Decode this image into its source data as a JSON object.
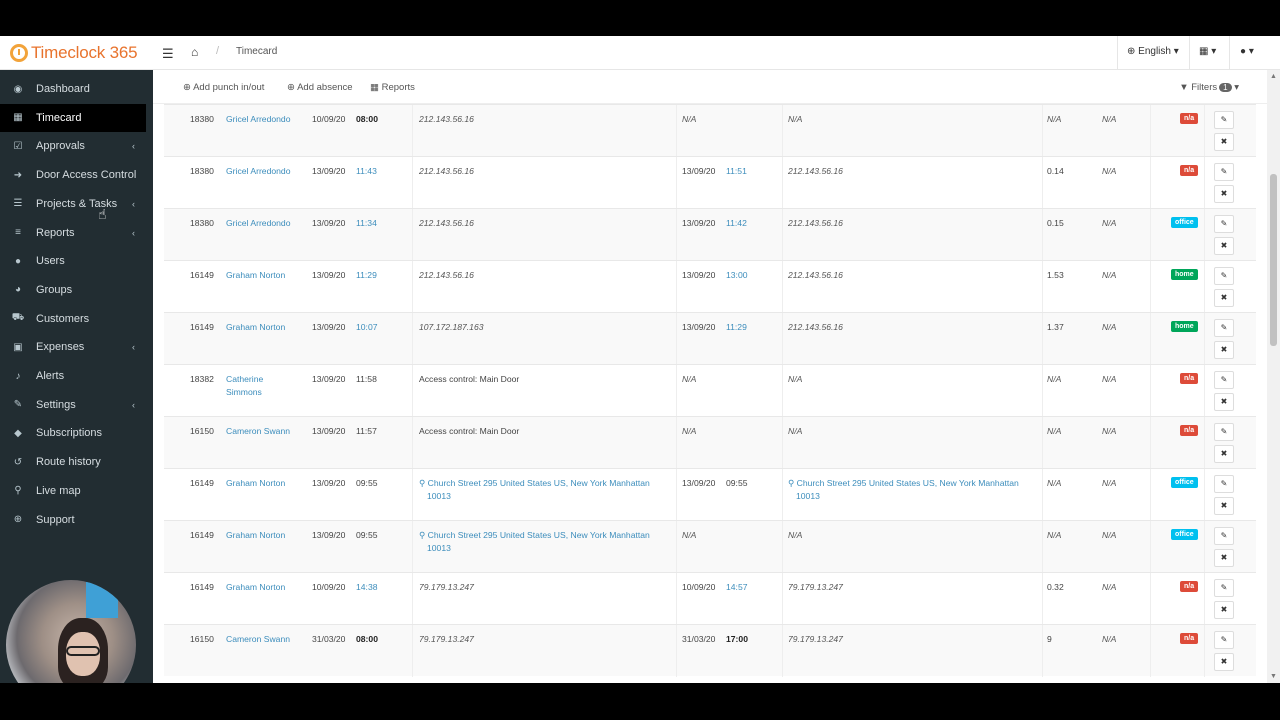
{
  "app": {
    "logo_text": "Timeclock 365",
    "breadcrumb_page": "Timecard",
    "language": "English ▾",
    "grid_menu": "▾",
    "user_menu": "▾"
  },
  "sidebar": {
    "items": [
      {
        "label": "Dashboard",
        "icon": "dashboard-icon",
        "glyph": "◉",
        "chevron": false
      },
      {
        "label": "Timecard",
        "icon": "calendar-icon",
        "glyph": "▦",
        "chevron": false,
        "active": true
      },
      {
        "label": "Approvals",
        "icon": "check-icon",
        "glyph": "☑",
        "chevron": true
      },
      {
        "label": "Door Access Control",
        "icon": "sign-in-icon",
        "glyph": "➜",
        "chevron": false
      },
      {
        "label": "Projects & Tasks",
        "icon": "list-icon",
        "glyph": "☰",
        "chevron": true
      },
      {
        "label": "Reports",
        "icon": "bars-icon",
        "glyph": "≡",
        "chevron": true
      },
      {
        "label": "Users",
        "icon": "user-icon",
        "glyph": "●",
        "chevron": false
      },
      {
        "label": "Groups",
        "icon": "users-icon",
        "glyph": "◕",
        "chevron": false
      },
      {
        "label": "Customers",
        "icon": "cart-icon",
        "glyph": "⛟",
        "chevron": false
      },
      {
        "label": "Expenses",
        "icon": "money-icon",
        "glyph": "▣",
        "chevron": true
      },
      {
        "label": "Alerts",
        "icon": "bell-icon",
        "glyph": "♪",
        "chevron": false
      },
      {
        "label": "Settings",
        "icon": "wrench-icon",
        "glyph": "✎",
        "chevron": true
      },
      {
        "label": "Subscriptions",
        "icon": "tags-icon",
        "glyph": "◆",
        "chevron": false
      },
      {
        "label": "Route history",
        "icon": "history-icon",
        "glyph": "↺",
        "chevron": false
      },
      {
        "label": "Live map",
        "icon": "map-marker-icon",
        "glyph": "⚲",
        "chevron": false
      },
      {
        "label": "Support",
        "icon": "globe-icon",
        "glyph": "⊕",
        "chevron": false
      }
    ],
    "chevron_glyph": "‹"
  },
  "toolbar": {
    "add_punch": "Add punch in/out",
    "add_absence": "Add absence",
    "reports": "Reports",
    "filters": "Filters",
    "filters_count": "1"
  },
  "rows": [
    {
      "id": "18380",
      "name": "Gricel Arredondo",
      "name2": "",
      "in_date": "10/09/20",
      "in_time": "08:00",
      "in_time_style": "bold",
      "in_loc": "212.143.56.16",
      "in_loc2": "",
      "in_loc_style": "ital",
      "out_date": "",
      "out_time": "",
      "out_time_style": "",
      "out_na": "N/A",
      "out_loc": "N/A",
      "out_loc2": "",
      "out_loc_style": "ital",
      "hours": "N/A",
      "hours_style": "ital",
      "extra": "N/A",
      "tag": "n/a",
      "tag_color": "red"
    },
    {
      "id": "18380",
      "name": "Gricel Arredondo",
      "name2": "",
      "in_date": "13/09/20",
      "in_time": "11:43",
      "in_time_style": "link",
      "in_loc": "212.143.56.16",
      "in_loc2": "",
      "in_loc_style": "ital",
      "out_date": "13/09/20",
      "out_time": "11:51",
      "out_time_style": "link",
      "out_na": "",
      "out_loc": "212.143.56.16",
      "out_loc2": "",
      "out_loc_style": "ital",
      "hours": "0.14",
      "hours_style": "",
      "extra": "N/A",
      "tag": "n/a",
      "tag_color": "red"
    },
    {
      "id": "18380",
      "name": "Gricel Arredondo",
      "name2": "",
      "in_date": "13/09/20",
      "in_time": "11:34",
      "in_time_style": "link",
      "in_loc": "212.143.56.16",
      "in_loc2": "",
      "in_loc_style": "ital",
      "out_date": "13/09/20",
      "out_time": "11:42",
      "out_time_style": "link",
      "out_na": "",
      "out_loc": "212.143.56.16",
      "out_loc2": "",
      "out_loc_style": "ital",
      "hours": "0.15",
      "hours_style": "",
      "extra": "N/A",
      "tag": "office",
      "tag_color": "blue"
    },
    {
      "id": "16149",
      "name": "Graham Norton",
      "name2": "",
      "in_date": "13/09/20",
      "in_time": "11:29",
      "in_time_style": "link",
      "in_loc": "212.143.56.16",
      "in_loc2": "",
      "in_loc_style": "ital",
      "out_date": "13/09/20",
      "out_time": "13:00",
      "out_time_style": "link",
      "out_na": "",
      "out_loc": "212.143.56.16",
      "out_loc2": "",
      "out_loc_style": "ital",
      "hours": "1.53",
      "hours_style": "",
      "extra": "N/A",
      "tag": "home",
      "tag_color": "green"
    },
    {
      "id": "16149",
      "name": "Graham Norton",
      "name2": "",
      "in_date": "13/09/20",
      "in_time": "10:07",
      "in_time_style": "link",
      "in_loc": "107.172.187.163",
      "in_loc2": "",
      "in_loc_style": "ital",
      "out_date": "13/09/20",
      "out_time": "11:29",
      "out_time_style": "link",
      "out_na": "",
      "out_loc": "212.143.56.16",
      "out_loc2": "",
      "out_loc_style": "ital",
      "hours": "1.37",
      "hours_style": "",
      "extra": "N/A",
      "tag": "home",
      "tag_color": "green"
    },
    {
      "id": "18382",
      "name": "Catherine",
      "name2": "Simmons",
      "in_date": "13/09/20",
      "in_time": "11:58",
      "in_time_style": "",
      "in_loc": "Access control: Main Door",
      "in_loc2": "",
      "in_loc_style": "",
      "out_date": "",
      "out_time": "",
      "out_time_style": "",
      "out_na": "N/A",
      "out_loc": "N/A",
      "out_loc2": "",
      "out_loc_style": "ital",
      "hours": "N/A",
      "hours_style": "ital",
      "extra": "N/A",
      "tag": "n/a",
      "tag_color": "red"
    },
    {
      "id": "16150",
      "name": "Cameron Swann",
      "name2": "",
      "in_date": "13/09/20",
      "in_time": "11:57",
      "in_time_style": "",
      "in_loc": "Access control: Main Door",
      "in_loc2": "",
      "in_loc_style": "",
      "out_date": "",
      "out_time": "",
      "out_time_style": "",
      "out_na": "N/A",
      "out_loc": "N/A",
      "out_loc2": "",
      "out_loc_style": "ital",
      "hours": "N/A",
      "hours_style": "ital",
      "extra": "N/A",
      "tag": "n/a",
      "tag_color": "red"
    },
    {
      "id": "16149",
      "name": "Graham Norton",
      "name2": "",
      "in_date": "13/09/20",
      "in_time": "09:55",
      "in_time_style": "",
      "in_loc": "⚲ Church Street 295 United States US, New York Manhattan",
      "in_loc2": "10013",
      "in_loc_style": "link",
      "out_date": "13/09/20",
      "out_time": "09:55",
      "out_time_style": "",
      "out_na": "",
      "out_loc": "⚲ Church Street 295 United States US, New York Manhattan",
      "out_loc2": "10013",
      "out_loc_style": "link",
      "hours": "N/A",
      "hours_style": "ital",
      "extra": "N/A",
      "tag": "office",
      "tag_color": "blue"
    },
    {
      "id": "16149",
      "name": "Graham Norton",
      "name2": "",
      "in_date": "13/09/20",
      "in_time": "09:55",
      "in_time_style": "",
      "in_loc": "⚲ Church Street 295 United States US, New York Manhattan",
      "in_loc2": "10013",
      "in_loc_style": "link",
      "out_date": "",
      "out_time": "",
      "out_time_style": "",
      "out_na": "N/A",
      "out_loc": "N/A",
      "out_loc2": "",
      "out_loc_style": "ital",
      "hours": "N/A",
      "hours_style": "ital",
      "extra": "N/A",
      "tag": "office",
      "tag_color": "blue"
    },
    {
      "id": "16149",
      "name": "Graham Norton",
      "name2": "",
      "in_date": "10/09/20",
      "in_time": "14:38",
      "in_time_style": "link",
      "in_loc": "79.179.13.247",
      "in_loc2": "",
      "in_loc_style": "ital",
      "out_date": "10/09/20",
      "out_time": "14:57",
      "out_time_style": "link",
      "out_na": "",
      "out_loc": "79.179.13.247",
      "out_loc2": "",
      "out_loc_style": "ital",
      "hours": "0.32",
      "hours_style": "",
      "extra": "N/A",
      "tag": "n/a",
      "tag_color": "red"
    },
    {
      "id": "16150",
      "name": "Cameron Swann",
      "name2": "",
      "in_date": "31/03/20",
      "in_time": "08:00",
      "in_time_style": "bold",
      "in_loc": "79.179.13.247",
      "in_loc2": "",
      "in_loc_style": "ital",
      "out_date": "31/03/20",
      "out_time": "17:00",
      "out_time_style": "bold",
      "out_na": "",
      "out_loc": "79.179.13.247",
      "out_loc2": "",
      "out_loc_style": "ital",
      "hours": "9",
      "hours_style": "",
      "extra": "N/A",
      "tag": "n/a",
      "tag_color": "red"
    }
  ],
  "colors": {
    "sidebar_bg": "#222d32",
    "link": "#3c8dbc",
    "tag_red": "#dd4b39",
    "tag_blue": "#00c0ef",
    "tag_green": "#00a65a",
    "logo": "#e8732d"
  }
}
